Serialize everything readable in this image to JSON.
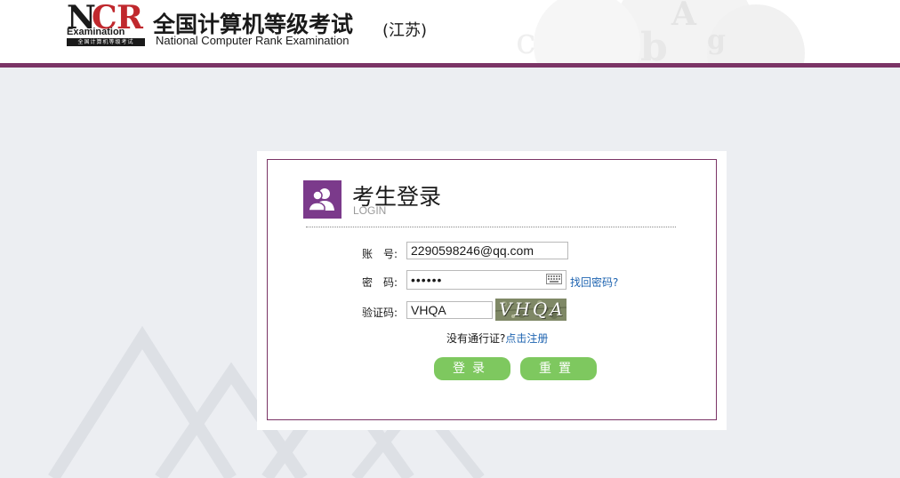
{
  "header": {
    "logo": {
      "letters": "NCR",
      "sub": "Examination",
      "strip": "全国计算机等级考试"
    },
    "title_cn": "全国计算机等级考试",
    "title_en": "National Computer Rank Examination",
    "region": "(江苏)"
  },
  "login": {
    "title": "考生登录",
    "subtitle": "LOGIN",
    "account_label": "账　号:",
    "account_value": "2290598246@qq.com",
    "password_label": "密　码:",
    "password_value": "••••••",
    "forgot_link": "找回密码?",
    "captcha_label": "验证码:",
    "captcha_value": "VHQA",
    "captcha_image_text": "VHQA",
    "no_pass_text": "没有通行证?",
    "register_link": "点击注册",
    "login_button": "登录",
    "reset_button": "重置"
  },
  "colors": {
    "brand": "#7b3466",
    "icon_bg": "#7b3a8b",
    "button": "#7ec85f",
    "link": "#1d63b0",
    "page_bg": "#eceef2"
  }
}
